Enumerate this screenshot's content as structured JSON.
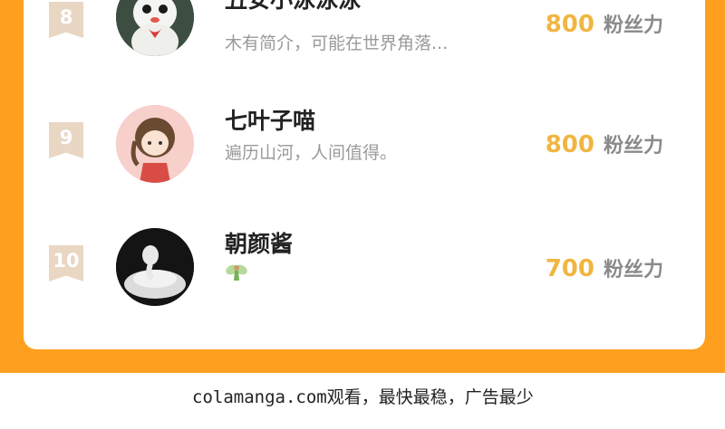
{
  "ranking": {
    "fans_label": "粉丝力",
    "entries": [
      {
        "rank": "8",
        "name": "丑安小泳泳泳",
        "bio": "木有简介，可能在世界角落...",
        "fans": "800",
        "avatar_icon": "white-bird-avatar-icon"
      },
      {
        "rank": "9",
        "name": "七叶子喵",
        "bio": "遍历山河，人间值得。",
        "fans": "800",
        "avatar_icon": "girl-avatar-icon"
      },
      {
        "rank": "10",
        "name": "朝颜酱",
        "bio": "",
        "fans": "700",
        "avatar_icon": "cat-avatar-icon",
        "badge_icon": "fairy-icon"
      }
    ]
  },
  "footer": {
    "text": "colamanga.com观看，最快最稳，广告最少"
  },
  "colors": {
    "frame": "#ff9f1f",
    "fans_number": "#f0b642",
    "rank_badge": "#e9d7c3"
  }
}
